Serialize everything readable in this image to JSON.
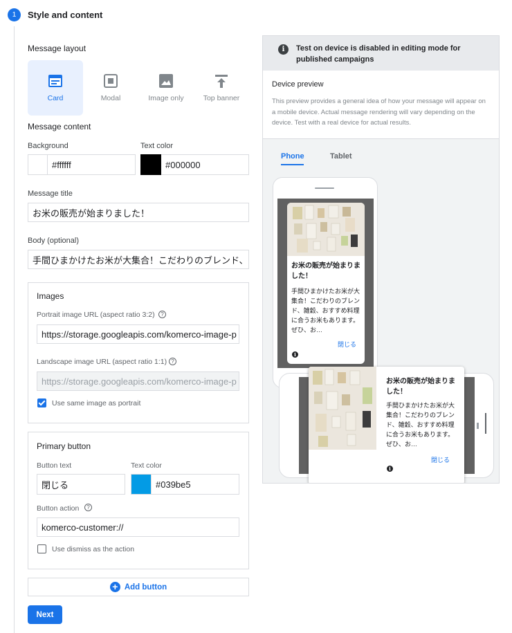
{
  "step": {
    "number": "1",
    "title": "Style and content"
  },
  "layout": {
    "heading": "Message layout",
    "options": [
      {
        "label": "Card",
        "icon": "card-layout-icon",
        "selected": true
      },
      {
        "label": "Modal",
        "icon": "modal-layout-icon",
        "selected": false
      },
      {
        "label": "Image only",
        "icon": "image-layout-icon",
        "selected": false
      },
      {
        "label": "Top banner",
        "icon": "top-banner-layout-icon",
        "selected": false
      }
    ]
  },
  "content": {
    "heading": "Message content",
    "background_label": "Background",
    "background_value": "#ffffff",
    "text_color_label": "Text color",
    "text_color_value": "#000000",
    "title_label": "Message title",
    "title_value": "お米の販売が始まりました！",
    "body_label": "Body (optional)",
    "body_value": "手間ひまかけたお米が大集合！こだわりのブレンド、"
  },
  "images": {
    "heading": "Images",
    "portrait_label": "Portrait image URL (aspect ratio 3:2)",
    "portrait_value": "https://storage.googleapis.com/komerco-image-p",
    "landscape_label": "Landscape image URL (aspect ratio 1:1)",
    "landscape_value": "https://storage.googleapis.com/komerco-image-p",
    "same_image_label": "Use same image as portrait",
    "same_image_checked": true
  },
  "primary_button": {
    "heading": "Primary button",
    "text_label": "Button text",
    "text_value": "閉じる",
    "color_label": "Text color",
    "color_value": "#039be5",
    "action_label": "Button action",
    "action_value": "komerco-customer://",
    "dismiss_label": "Use dismiss as the action",
    "dismiss_checked": false
  },
  "actions": {
    "add_button": "Add button",
    "next": "Next"
  },
  "preview": {
    "banner": "Test on device is disabled in editing mode for published campaigns",
    "title": "Device preview",
    "description": "This preview provides a general idea of how your message will appear on a mobile device. Actual message rendering will vary depending on the device. Test with a real device for actual results.",
    "tabs": [
      "Phone",
      "Tablet"
    ],
    "active_tab": "Phone",
    "card_title": "お米の販売が始まりました！",
    "card_body": "手間ひまかけたお米が大集合！こだわりのブレンド、雑穀、おすすめ料理に合うお米もあります。ぜひ、お…",
    "card_button": "閉じる"
  },
  "colors": {
    "accent": "#1a73e8",
    "button_text_color": "#039be5"
  }
}
